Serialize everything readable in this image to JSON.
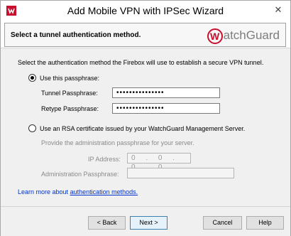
{
  "window": {
    "title": "Add Mobile VPN with IPSec Wizard",
    "close_glyph": "✕"
  },
  "header": {
    "title": "Select a tunnel authentication method.",
    "logo_text": "atchGuard",
    "logo_letter": "W"
  },
  "content": {
    "description": "Select the authentication method the Firebox will use to establish a secure VPN tunnel.",
    "passphrase_option": {
      "label": "Use this passphrase:",
      "selected": true,
      "tunnel_label": "Tunnel Passphrase:",
      "tunnel_value": "•••••••••••••••",
      "retype_label": "Retype Passphrase:",
      "retype_value": "•••••••••••••••"
    },
    "rsa_option": {
      "label": "Use an RSA certificate issued by your WatchGuard Management Server.",
      "selected": false,
      "hint": "Provide the administration passphrase for your server.",
      "ip_label": "IP Address:",
      "ip_value": "0 . 0 . 0 . 0",
      "admin_label": "Administration Passphrase:",
      "admin_value": ""
    },
    "learn_more_prefix": "Learn more about",
    "learn_more_link": "authentication methods."
  },
  "footer": {
    "back_label": "< Back",
    "next_label": "Next >",
    "cancel_label": "Cancel",
    "help_label": "Help"
  },
  "colors": {
    "brand_red": "#c8102e",
    "link_blue": "#0033cc"
  }
}
